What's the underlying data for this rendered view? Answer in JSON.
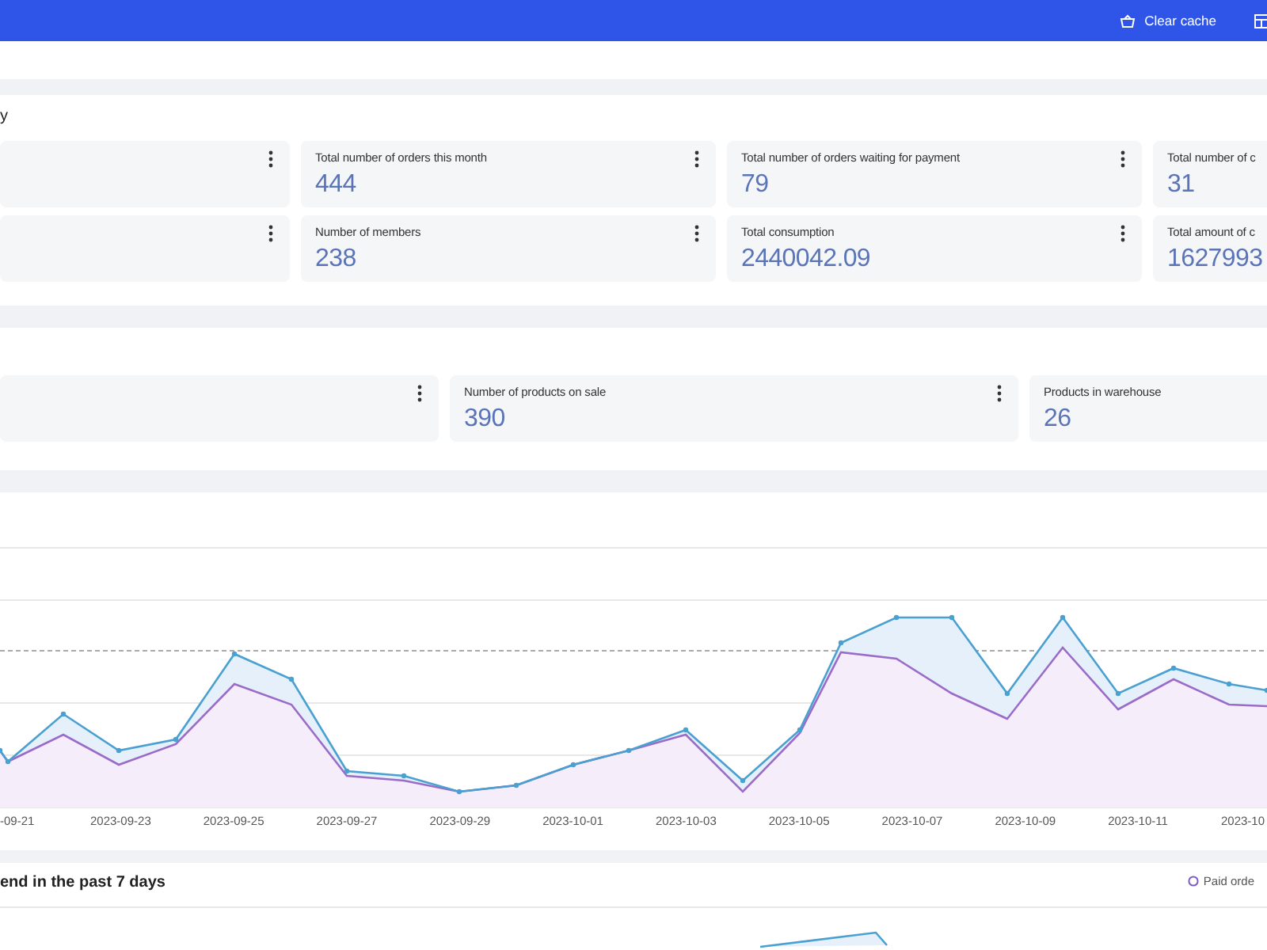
{
  "header": {
    "actions": [
      {
        "kind": "basket",
        "label": "Clear cache"
      },
      {
        "kind": "grid"
      }
    ]
  },
  "order_panel": {
    "title": "y",
    "rows": [
      {
        "cards": [
          {
            "label": "Total number of orders this month",
            "value": "444"
          },
          {
            "label": "Total number of orders waiting for payment",
            "value": "79"
          },
          {
            "label": "Total number of c",
            "value": "31"
          }
        ]
      },
      {
        "cards": [
          {
            "label": "Number of members",
            "value": "238"
          },
          {
            "label": "Total consumption",
            "value": "2440042.09"
          },
          {
            "label": "Total amount of c",
            "value": "1627993"
          }
        ]
      }
    ]
  },
  "product_panel": {
    "cards": [
      {
        "label": "Number of products on sale",
        "value": "390"
      },
      {
        "label": "Products in warehouse",
        "value": "26"
      }
    ]
  },
  "trend_chart": {
    "x_labels": [
      "-09-21",
      "2023-09-23",
      "2023-09-25",
      "2023-09-27",
      "2023-09-29",
      "2023-10-01",
      "2023-10-03",
      "2023-10-05",
      "2023-10-07",
      "2023-10-09",
      "2023-10-11",
      "2023-10"
    ]
  },
  "weekly_panel": {
    "title": "end in the past 7 days",
    "legend": "Paid orde"
  }
}
